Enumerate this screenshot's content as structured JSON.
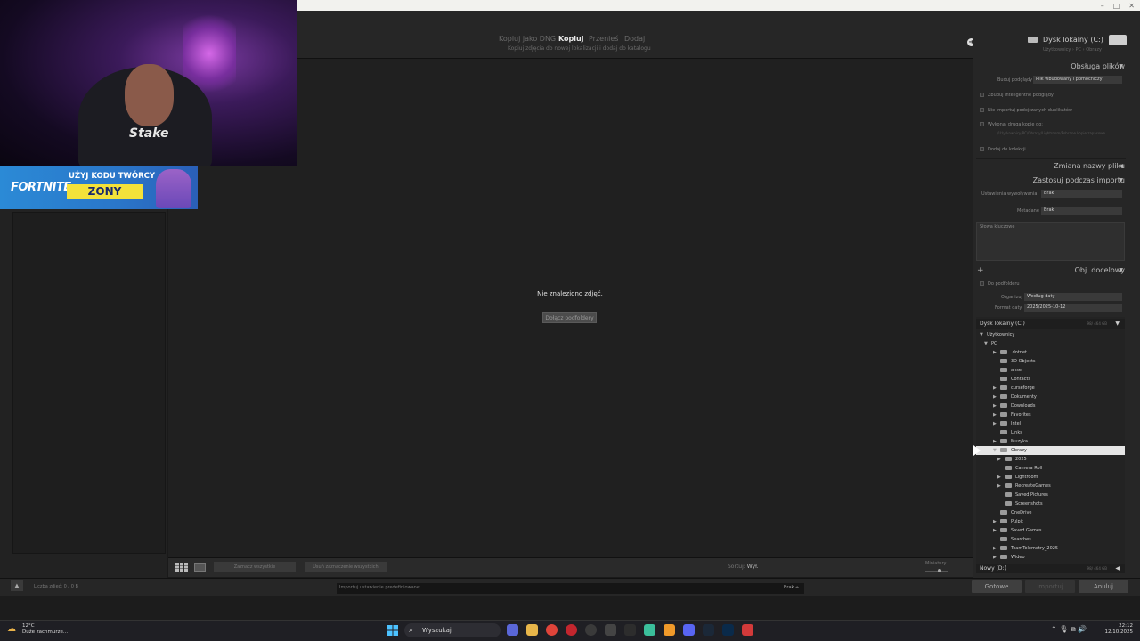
{
  "header": {
    "modes": [
      "Kopiuj jako DNG",
      "Kopiuj",
      "Przenieś",
      "Dodaj"
    ],
    "active_mode": "Kopiuj",
    "mode_subtitle": "Kopiuj zdjęcia do nowej lokalizacji i dodaj do katalogu",
    "destination_drive": "Dysk lokalny (C:)",
    "destination_path": "Użytkownicy › PC › Obrazy"
  },
  "center": {
    "empty_message": "Nie znaleziono zdjęć.",
    "include_subfolders": "Dołącz podfoldery"
  },
  "toolbar": {
    "check_all": "Zaznacz wszystkie",
    "uncheck_all": "Usuń zaznaczenie wszystkich",
    "sort_label": "Sortuj:",
    "sort_value": "Wył.",
    "thumbnails_label": "Miniatury"
  },
  "right_panel": {
    "file_handling": {
      "title": "Obsługa plików",
      "build_previews_label": "Buduj podglądy",
      "build_previews_value": "Plik wbudowany i pomocniczy",
      "smart_previews": "Zbuduj inteligentne podglądy",
      "no_duplicates": "Nie importuj podejrzanych duplikatów",
      "second_copy": "Wykonaj drugą kopię do:",
      "second_copy_path": "/Użytkownicy/PC/Obrazy/Lightroom/Pobrane kopie zapasowe",
      "add_to_collection": "Dodaj do kolekcji"
    },
    "file_renaming": {
      "title": "Zmiana nazwy pliku"
    },
    "apply_during_import": {
      "title": "Zastosuj podczas importu",
      "develop_label": "Ustawienia wywoływania",
      "develop_value": "Brak",
      "metadata_label": "Metadane",
      "metadata_value": "Brak",
      "keywords_label": "Słowa kluczowe"
    },
    "destination": {
      "title": "Obj. docelowy",
      "into_subfolder": "Do podfolderu",
      "organize_label": "Organizuj",
      "organize_value": "Według daty",
      "date_format_label": "Format daty",
      "date_format_value": "2025/2025-10-12",
      "drive_c": "Dysk lokalny (C:)",
      "drive_c_size": "98/ 464 GB",
      "drive_d": "Nowy (D:)",
      "drive_d_size": "98/ 464 GB",
      "tree": [
        {
          "label": "Użytkownicy",
          "depth": 0,
          "expand": "open",
          "folder": false
        },
        {
          "label": "PC",
          "depth": 1,
          "expand": "open",
          "folder": false
        },
        {
          "label": ".dotnet",
          "depth": 2,
          "expand": "closed",
          "folder": true
        },
        {
          "label": "3D Objects",
          "depth": 2,
          "expand": "none",
          "folder": true
        },
        {
          "label": "ansel",
          "depth": 2,
          "expand": "none",
          "folder": true
        },
        {
          "label": "Contacts",
          "depth": 2,
          "expand": "none",
          "folder": true
        },
        {
          "label": "curseforge",
          "depth": 2,
          "expand": "closed",
          "folder": true
        },
        {
          "label": "Dokumenty",
          "depth": 2,
          "expand": "closed",
          "folder": true
        },
        {
          "label": "Downloads",
          "depth": 2,
          "expand": "closed",
          "folder": true
        },
        {
          "label": "Favorites",
          "depth": 2,
          "expand": "closed",
          "folder": true
        },
        {
          "label": "Intel",
          "depth": 2,
          "expand": "closed",
          "folder": true
        },
        {
          "label": "Links",
          "depth": 2,
          "expand": "none",
          "folder": true
        },
        {
          "label": "Muzyka",
          "depth": 2,
          "expand": "closed",
          "folder": true
        },
        {
          "label": "Obrazy",
          "depth": 2,
          "expand": "open",
          "folder": true,
          "selected": true
        },
        {
          "label": "2025",
          "depth": 3,
          "expand": "closed",
          "folder": true
        },
        {
          "label": "Camera Roll",
          "depth": 3,
          "expand": "none",
          "folder": true
        },
        {
          "label": "Lightroom",
          "depth": 3,
          "expand": "closed",
          "folder": true
        },
        {
          "label": "RecreateGames",
          "depth": 3,
          "expand": "closed",
          "folder": true
        },
        {
          "label": "Saved Pictures",
          "depth": 3,
          "expand": "none",
          "folder": true
        },
        {
          "label": "Screenshots",
          "depth": 3,
          "expand": "none",
          "folder": true
        },
        {
          "label": "OneDrive",
          "depth": 2,
          "expand": "none",
          "folder": true
        },
        {
          "label": "Pulpit",
          "depth": 2,
          "expand": "closed",
          "folder": true
        },
        {
          "label": "Saved Games",
          "depth": 2,
          "expand": "closed",
          "folder": true
        },
        {
          "label": "Searches",
          "depth": 2,
          "expand": "none",
          "folder": true
        },
        {
          "label": "TeamTelemetry_2025",
          "depth": 2,
          "expand": "closed",
          "folder": true
        },
        {
          "label": "Wideo",
          "depth": 2,
          "expand": "closed",
          "folder": true
        }
      ]
    }
  },
  "bottom": {
    "count": "Liczba zdjęć: 0 / 0 B",
    "preset_label": "Importuj ustawienie predefiniowane:",
    "preset_value": "Brak ÷",
    "done": "Gotowe",
    "import": "Importuj",
    "cancel": "Anuluj"
  },
  "overlay": {
    "shirt_text": "Stake",
    "banner_game": "FORTNITE",
    "banner_text": "UŻYJ KODU TWÓRCY",
    "banner_code": "ZONY"
  },
  "taskbar": {
    "temperature": "12°C",
    "weather": "Duże zachmurze...",
    "search_placeholder": "Wyszukaj",
    "time": "22:12",
    "date": "12.10.2025"
  },
  "colors": {
    "panel_bg": "#262626",
    "center_bg": "#202020",
    "banner_yellow": "#f4e23a",
    "banner_blue": "#2a76c9"
  }
}
